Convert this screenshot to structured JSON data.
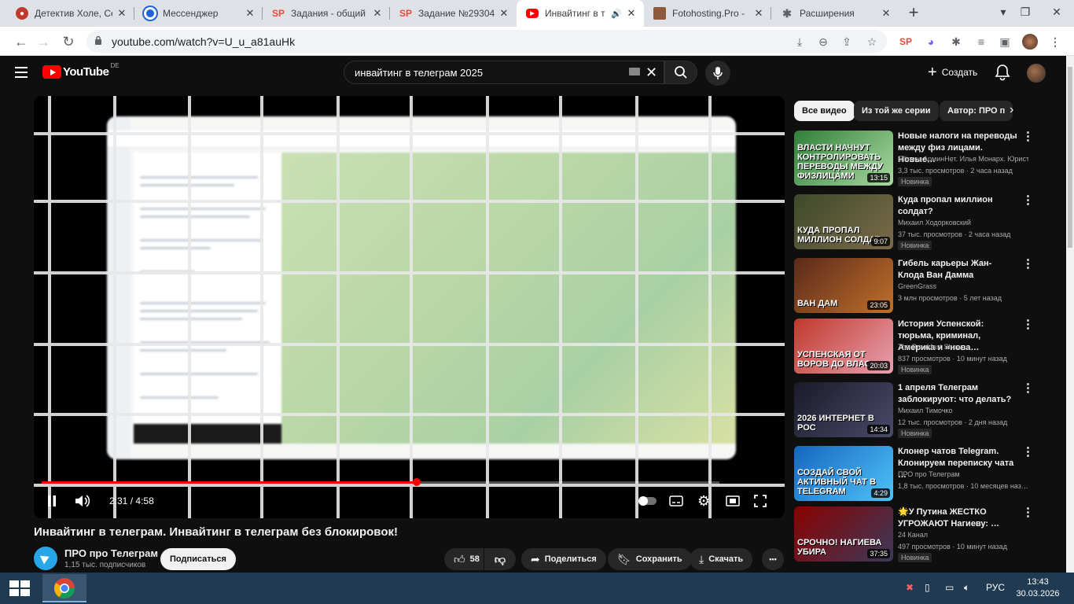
{
  "browser": {
    "tabs": [
      {
        "title": "Детектив Холе, Се",
        "favicon_color": "#c0392b"
      },
      {
        "title": "Мессенджер",
        "favicon_color": "#1e63d6"
      },
      {
        "title": "Задания - общий",
        "favicon_color": "#e74c3c",
        "favicon_text": "SP"
      },
      {
        "title": "Задание №29304",
        "favicon_color": "#e74c3c",
        "favicon_text": "SP"
      },
      {
        "title": "Инвайтинг в т",
        "favicon_color": "#ff0000",
        "active": true
      },
      {
        "title": "Fotohosting.Pro -",
        "favicon_color": "#8e5a3a"
      },
      {
        "title": "Расширения",
        "favicon_color": "#5f6368"
      }
    ],
    "close_glyph": "✕",
    "new_tab": "+",
    "url": "youtube.com/watch?v=U_u_a81auHk",
    "window_controls": [
      "▾",
      "—",
      "❐",
      "✕"
    ]
  },
  "yt": {
    "logo_word": "YouTube",
    "logo_region": "DE",
    "search_query": "инвайтинг в телеграм 2025",
    "create_label": "Создать",
    "player": {
      "time_current": "2:31",
      "time_sep": "/",
      "time_total": "4:58",
      "progress": 0.553
    },
    "video_title": "Инвайтинг в телеграм. Инвайтинг в телеграм без блокировок!",
    "channel": {
      "name": "ПРО про Телеграм",
      "subs": "1,15 тыс. подписчиков",
      "subscribe": "Подписаться"
    },
    "actions": {
      "likes": "58",
      "share": "Поделиться",
      "save": "Сохранить",
      "download": "Скачать",
      "more": "•••"
    },
    "chips": [
      "Все видео",
      "Из той же серии",
      "Автор: ПРО п"
    ],
    "recommendations": [
      {
        "title": "Новые налоги на переводы между физ лицами. Новые…",
        "channel": "Elline и АрминНет. Илья Монарх. Юрист.",
        "meta": "3,3 тыс. просмотров · 2 часа назад",
        "badge": "Новинка",
        "duration": "13:15",
        "thumb_text": "ВЛАСТИ НАЧНУТ КОНТРОЛИРОВАТЬ ПЕРЕВОДЫ МЕЖДУ ФИЗЛИЦАМИ",
        "c1": "#2f7f3a",
        "c2": "#a8d8a0"
      },
      {
        "title": "Куда пропал миллион солдат?",
        "channel": "Михаил Ходорковский",
        "meta": "37 тыс. просмотров · 2 часа назад",
        "badge": "Новинка",
        "duration": "9:07",
        "thumb_text": "КУДА ПРОПАЛ МИЛЛИОН СОЛДАТ",
        "c1": "#3d4a2a",
        "c2": "#7a6a4a"
      },
      {
        "title": "Гибель карьеры Жан-Клода Ван Дамма",
        "channel": "GreenGrass",
        "meta": "3 млн просмотров · 5 лет назад",
        "badge": "",
        "duration": "23:05",
        "thumb_text": "ВАН ДАМ",
        "c1": "#5a2a1a",
        "c2": "#c0702a"
      },
      {
        "title": "История Успенской: тюрьма, криминал, Америка и «нова…",
        "channel": "The Breakfast Show",
        "meta": "837 просмотров · 10 минут назад",
        "badge": "Новинка",
        "duration": "20:03",
        "thumb_text": "УСПЕНСКАЯ ОТ ВОРОВ ДО ВЛАС",
        "c1": "#c0392b",
        "c2": "#e8a0b0"
      },
      {
        "title": "1 апреля Телеграм заблокируют: что делать?",
        "channel": "Михаил Тимочко",
        "meta": "12 тыс. просмотров · 2 дня назад",
        "badge": "Новинка",
        "duration": "14:34",
        "thumb_text": "2026 ИНТЕРНЕТ В РОС",
        "c1": "#1a1a2a",
        "c2": "#4a4a6a"
      },
      {
        "title": "Клонер чатов Telegram. Клонируем переписку чата …",
        "channel": "ПРО про Телеграм",
        "meta": "1,8 тыс. просмотров · 10 месяцев наз…",
        "badge": "",
        "duration": "4:29",
        "thumb_text": "СОЗДАЙ СВОЙ АКТИВНЫЙ ЧАТ В TELEGRAM",
        "c1": "#1565c0",
        "c2": "#4fc3f7"
      },
      {
        "title": "🌟У Путина ЖЕСТКО УГРОЖАЮТ Нагиеву: …",
        "channel": "24 Канал",
        "meta": "497 просмотров · 10 минут назад",
        "badge": "Новинка",
        "duration": "37:35",
        "thumb_text": "СРОЧНО! НАГИЕВА УБИРА",
        "c1": "#8b0000",
        "c2": "#3a3a5a"
      }
    ]
  },
  "taskbar": {
    "lang": "РУС",
    "time": "13:43",
    "date": "30.03.2026"
  }
}
